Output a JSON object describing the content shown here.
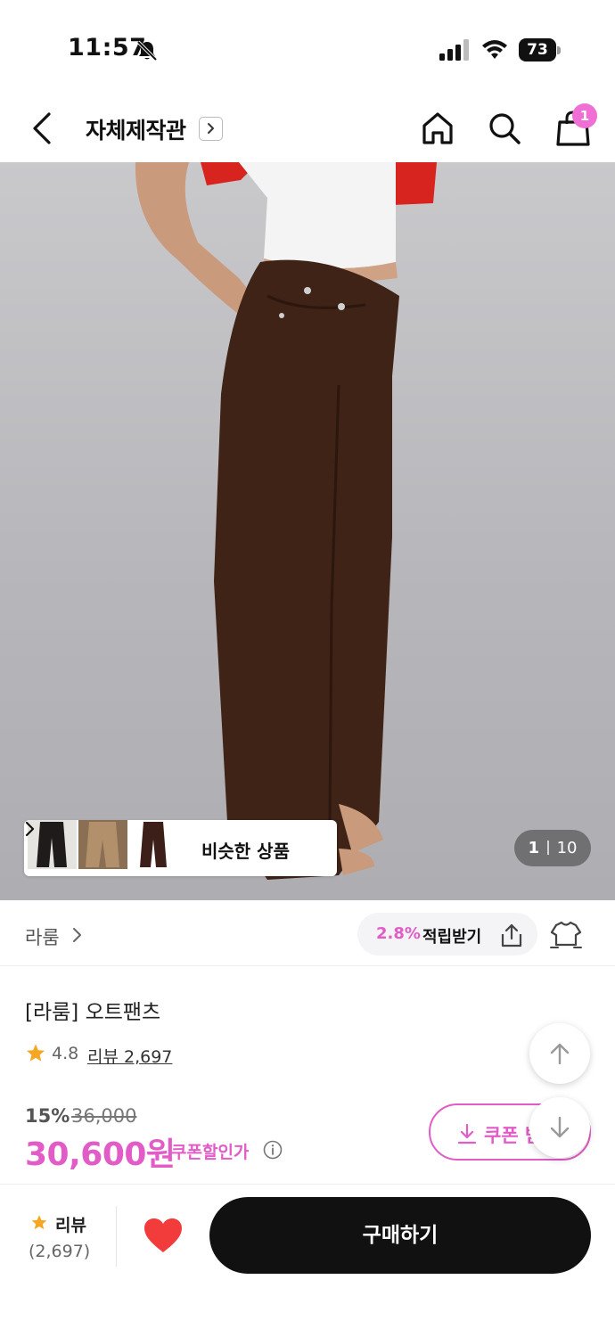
{
  "status_bar": {
    "time": "11:57",
    "battery": "73"
  },
  "header": {
    "title": "자체제작관",
    "cart_count": "1"
  },
  "gallery": {
    "similar_label": "비슷한 상품",
    "current_image": "1",
    "total_images": "10"
  },
  "brand": {
    "name": "라룸",
    "points_rate": "2.8%",
    "points_label": "적립받기"
  },
  "product": {
    "name": "[라룸] 오트팬츠",
    "rating": "4.8",
    "review_link": "리뷰 2,697",
    "discount_rate": "15%",
    "original_price": "36,000",
    "sale_price": "30,600원",
    "coupon_price_label": "쿠폰할인가",
    "coupon_button": "쿠폰 받기"
  },
  "bottom_bar": {
    "review_label": "리뷰",
    "review_count": "(2,697)",
    "buy_label": "구매하기"
  },
  "colors": {
    "accent": "#e25cc8",
    "badge": "#f06fd5",
    "buy_button": "#111111",
    "heart": "#f23b3b",
    "star": "#f5a623"
  },
  "icons": [
    "bell-off-icon",
    "signal-icon",
    "wifi-icon",
    "battery-icon",
    "back-arrow-icon",
    "chevron-right-icon",
    "home-icon",
    "search-icon",
    "shopping-bag-icon",
    "share-icon",
    "wardrobe-icon",
    "star-icon",
    "info-icon",
    "download-icon",
    "arrow-up-icon",
    "arrow-down-icon",
    "heart-icon"
  ]
}
